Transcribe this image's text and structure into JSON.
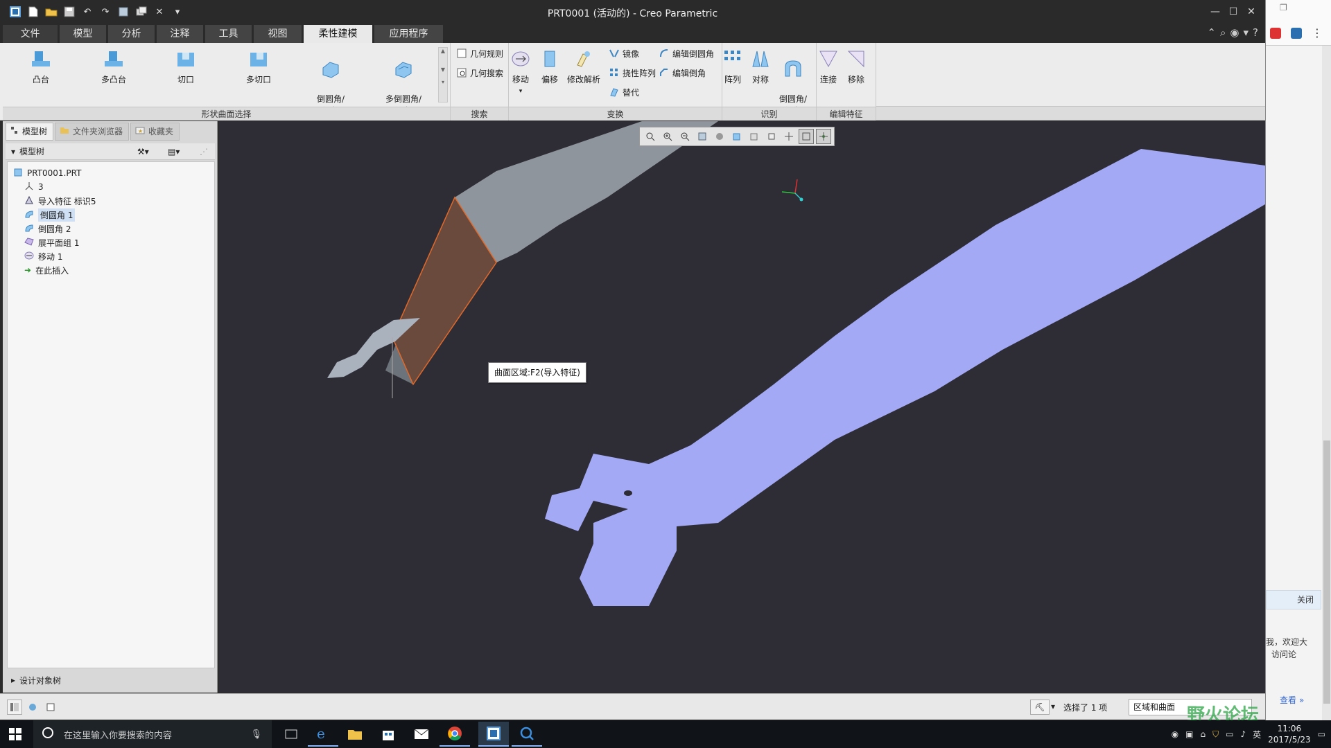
{
  "window": {
    "title": "PRT0001 (活动的) - Creo Parametric"
  },
  "menu_tabs": [
    {
      "label": "文件"
    },
    {
      "label": "模型"
    },
    {
      "label": "分析"
    },
    {
      "label": "注释"
    },
    {
      "label": "工具"
    },
    {
      "label": "视图"
    },
    {
      "label": "柔性建模"
    },
    {
      "label": "应用程序"
    }
  ],
  "active_tab": "柔性建模",
  "ribbon": {
    "groups": {
      "shape_surface": "形状曲面选择",
      "search": "搜索",
      "transform": "变换",
      "recognize": "识别",
      "edit_feature": "编辑特征"
    },
    "shape_buttons": [
      {
        "label": "凸台"
      },
      {
        "label": "多凸台"
      },
      {
        "label": "切口"
      },
      {
        "label": "多切口"
      },
      {
        "label": "倒圆角/\n倒角"
      },
      {
        "label": "多倒圆角/\n倒角"
      }
    ],
    "search_buttons": [
      {
        "label": "几何规则"
      },
      {
        "label": "几何搜索"
      }
    ],
    "transform_big": [
      {
        "label": "移动"
      },
      {
        "label": "偏移"
      },
      {
        "label": "修改解析"
      }
    ],
    "transform_small": [
      {
        "label": "镜像"
      },
      {
        "label": "挠性阵列"
      },
      {
        "label": "替代"
      },
      {
        "label": "编辑倒圆角"
      },
      {
        "label": "编辑倒角"
      }
    ],
    "recognize_buttons": [
      {
        "label": "阵列"
      },
      {
        "label": "对称"
      },
      {
        "label": "倒圆角/\n倒角"
      }
    ],
    "edit_buttons": [
      {
        "label": "连接"
      },
      {
        "label": "移除"
      }
    ]
  },
  "left_panel": {
    "tabs": [
      {
        "label": "模型树"
      },
      {
        "label": "文件夹浏览器"
      },
      {
        "label": "收藏夹"
      }
    ],
    "tree_header": "模型树",
    "tree_items": [
      {
        "label": "PRT0001.PRT",
        "selected": false
      },
      {
        "label": "3",
        "selected": false
      },
      {
        "label": "导入特征 标识5",
        "selected": false
      },
      {
        "label": "倒圆角 1",
        "selected": true
      },
      {
        "label": "倒圆角 2",
        "selected": false
      },
      {
        "label": "展平面组 1",
        "selected": false
      },
      {
        "label": "移动 1",
        "selected": false
      },
      {
        "label": "在此插入",
        "selected": false
      }
    ],
    "design_tree": "设计对象树"
  },
  "viewport": {
    "tooltip": "曲面区域:F2(导入特征)",
    "colors": {
      "background": "#2e2d36",
      "part_blue": "#a3a9f5",
      "part_gray": "#8f959d",
      "highlight": "#e0692a"
    }
  },
  "statusbar": {
    "selection": "选择了 1 项",
    "filter": "区域和曲面"
  },
  "right_strip": {
    "close": "关闭",
    "line1": "我，欢迎大",
    "line2": "访问论",
    "more": "查看 »"
  },
  "watermark": "野火论坛",
  "taskbar": {
    "search_placeholder": "在这里输入你要搜索的内容",
    "ime": "英",
    "time": "11:06",
    "date": "2017/5/23"
  }
}
